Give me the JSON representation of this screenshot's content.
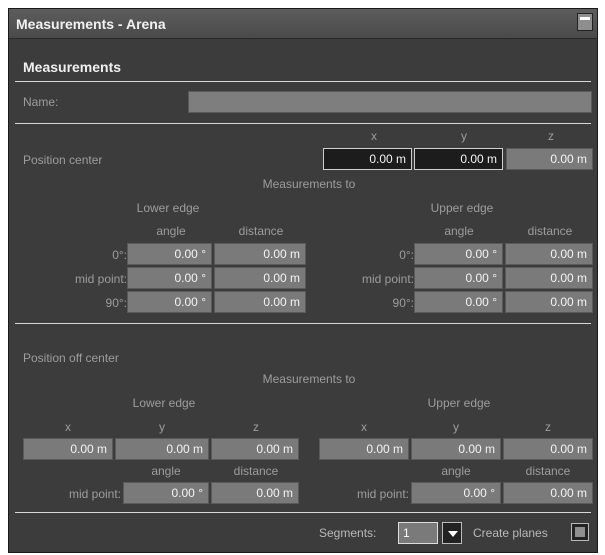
{
  "window": {
    "title": "Measurements - Arena"
  },
  "section_title": "Measurements",
  "name": {
    "label": "Name:",
    "value": ""
  },
  "axes": {
    "x": "x",
    "y": "y",
    "z": "z"
  },
  "position_center": {
    "label": "Position center",
    "x": "0.00 m",
    "y": "0.00 m",
    "z": "0.00 m",
    "measurements_to": "Measurements to",
    "lower_edge": "Lower edge",
    "upper_edge": "Upper edge",
    "angle": "angle",
    "distance": "distance",
    "rows": [
      {
        "label": "0°:",
        "lower_angle": "0.00 °",
        "lower_distance": "0.00 m",
        "upper_angle": "0.00 °",
        "upper_distance": "0.00 m"
      },
      {
        "label": "mid point:",
        "lower_angle": "0.00 °",
        "lower_distance": "0.00 m",
        "upper_angle": "0.00 °",
        "upper_distance": "0.00 m"
      },
      {
        "label": "90°:",
        "lower_angle": "0.00 °",
        "lower_distance": "0.00 m",
        "upper_angle": "0.00 °",
        "upper_distance": "0.00 m"
      }
    ]
  },
  "position_off_center": {
    "label": "Position off center",
    "measurements_to": "Measurements to",
    "lower_edge": "Lower edge",
    "upper_edge": "Upper edge",
    "lower_xyz": {
      "x": "0.00 m",
      "y": "0.00 m",
      "z": "0.00 m"
    },
    "upper_xyz": {
      "x": "0.00 m",
      "y": "0.00 m",
      "z": "0.00 m"
    },
    "angle": "angle",
    "distance": "distance",
    "mid_label": "mid point:",
    "lower_angle": "0.00 °",
    "lower_distance": "0.00 m",
    "upper_angle": "0.00 °",
    "upper_distance": "0.00 m"
  },
  "footer": {
    "segments_label": "Segments:",
    "segments_value": "1",
    "create_planes_label": "Create planes",
    "create_planes_checked": false
  }
}
